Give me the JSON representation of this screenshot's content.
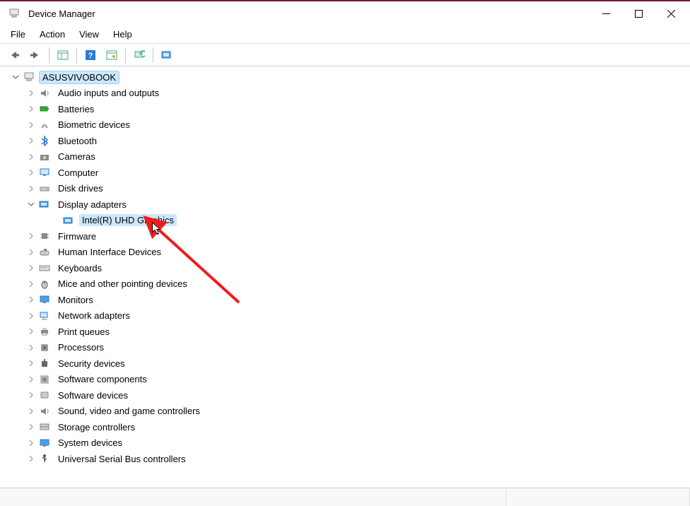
{
  "window": {
    "title": "Device Manager"
  },
  "menu": {
    "file": "File",
    "action": "Action",
    "view": "View",
    "help": "Help"
  },
  "tree": {
    "root": "ASUSVIVOBOOK",
    "items": [
      {
        "label": "Audio inputs and outputs"
      },
      {
        "label": "Batteries"
      },
      {
        "label": "Biometric devices"
      },
      {
        "label": "Bluetooth"
      },
      {
        "label": "Cameras"
      },
      {
        "label": "Computer"
      },
      {
        "label": "Disk drives"
      },
      {
        "label": "Display adapters",
        "expanded": true,
        "children": [
          {
            "label": "Intel(R) UHD Graphics",
            "selected": true
          }
        ]
      },
      {
        "label": "Firmware"
      },
      {
        "label": "Human Interface Devices"
      },
      {
        "label": "Keyboards"
      },
      {
        "label": "Mice and other pointing devices"
      },
      {
        "label": "Monitors"
      },
      {
        "label": "Network adapters"
      },
      {
        "label": "Print queues"
      },
      {
        "label": "Processors"
      },
      {
        "label": "Security devices"
      },
      {
        "label": "Software components"
      },
      {
        "label": "Software devices"
      },
      {
        "label": "Sound, video and game controllers"
      },
      {
        "label": "Storage controllers"
      },
      {
        "label": "System devices"
      },
      {
        "label": "Universal Serial Bus controllers"
      }
    ]
  }
}
